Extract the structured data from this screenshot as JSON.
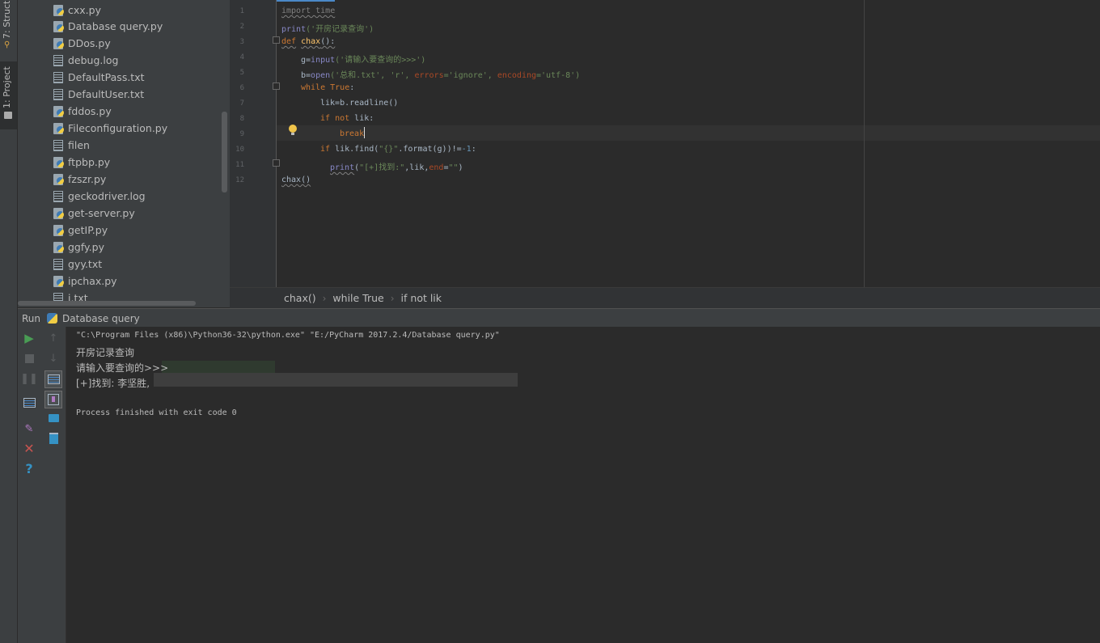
{
  "toolstrip": {
    "structure_label": "7: Structure",
    "project_label": "1: Project"
  },
  "project": {
    "files": [
      {
        "name": "cxx.py",
        "type": "py"
      },
      {
        "name": "Database query.py",
        "type": "py"
      },
      {
        "name": "DDos.py",
        "type": "py"
      },
      {
        "name": "debug.log",
        "type": "txt"
      },
      {
        "name": "DefaultPass.txt",
        "type": "txt"
      },
      {
        "name": "DefaultUser.txt",
        "type": "txt"
      },
      {
        "name": "fddos.py",
        "type": "py"
      },
      {
        "name": "Fileconfiguration.py",
        "type": "py"
      },
      {
        "name": "filen",
        "type": "txt"
      },
      {
        "name": "ftpbp.py",
        "type": "py"
      },
      {
        "name": "fzszr.py",
        "type": "py"
      },
      {
        "name": "geckodriver.log",
        "type": "txt"
      },
      {
        "name": "get-server.py",
        "type": "py"
      },
      {
        "name": "getIP.py",
        "type": "py"
      },
      {
        "name": "ggfy.py",
        "type": "py"
      },
      {
        "name": "gyy.txt",
        "type": "txt"
      },
      {
        "name": "ipchax.py",
        "type": "py"
      },
      {
        "name": "j.txt",
        "type": "txt"
      }
    ]
  },
  "editor": {
    "line_numbers": [
      "1",
      "2",
      "3",
      "4",
      "5",
      "6",
      "7",
      "8",
      "9",
      "10",
      "11",
      "12"
    ],
    "code": {
      "l1": "import time",
      "l2_print": "print",
      "l2_str": "('开房记录查询')",
      "l3_def": "def",
      "l3_name": "chax",
      "l3_rest": "():",
      "l4_var": "g=",
      "l4_input": "input",
      "l4_str": "('请输入要查询的>>>')",
      "l5_var": "b=",
      "l5_open": "open",
      "l5_a": "('总和.txt',",
      "l5_b": "'r',",
      "l5_errors": "errors",
      "l5_c": "='ignore',",
      "l5_encoding": "encoding",
      "l5_d": "='utf-8')",
      "l6_while": "while",
      "l6_true": "True",
      "l6_colon": ":",
      "l7": "lik=b.readline()",
      "l8_if": "if",
      "l8_not": "not",
      "l8_rest": "lik:",
      "l9_break": "break",
      "l10_if": "if",
      "l10_a": "lik.find(",
      "l10_str": "\"{}\"",
      "l10_b": ".format(g))!=",
      "l10_num": "-1",
      "l10_colon": ":",
      "l11_print": "print",
      "l11_a": "(",
      "l11_str": "\"[+]找到:\"",
      "l11_b": ",lik,",
      "l11_end": "end",
      "l11_c": "=",
      "l11_str2": "\"\"",
      "l11_d": ")",
      "l12": "chax()"
    }
  },
  "breadcrumb": {
    "items": [
      "chax()",
      "while True",
      "if not lik"
    ]
  },
  "run": {
    "label": "Run",
    "config_name": "Database query",
    "console": {
      "command": "\"C:\\Program Files (x86)\\Python36-32\\python.exe\" \"E:/PyCharm 2017.2.4/Database query.py\"",
      "line1": "开房记录查询",
      "line2": "请输入要查询的>>>",
      "line3": "[+]找到: 李坚胜,",
      "line4": "Process finished with exit code 0"
    }
  },
  "colors": {
    "keyword": "#cc7832",
    "string": "#6a8759",
    "number": "#6897bb",
    "run_green": "#499c54",
    "stop_red": "#c75450",
    "help_blue": "#3592c4"
  }
}
